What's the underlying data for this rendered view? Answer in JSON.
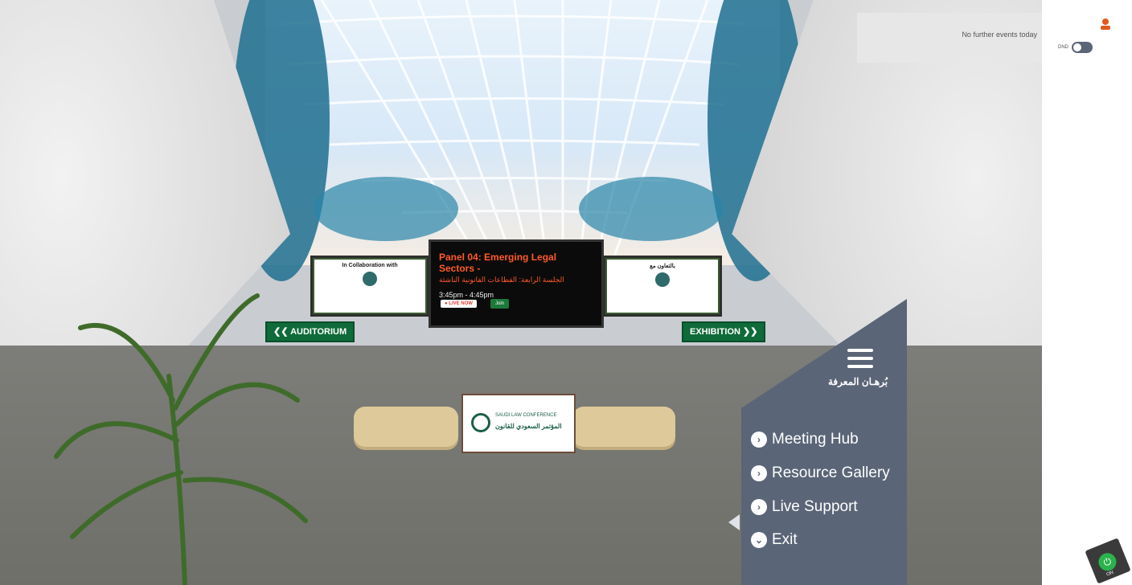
{
  "scene": {
    "screen_left_caption": "In Collaboration with",
    "screen_right_caption": "بالتعاون مع",
    "panel": {
      "title": "Panel 04: Emerging Legal Sectors -",
      "title_arabic": "الجلسة الرابعة: القطاعات القانونية الناشئة",
      "time": "3:45pm - 4:45pm",
      "live_label": "● LIVE NOW",
      "join_label": "Join"
    },
    "sign_auditorium": "❮❮ AUDITORIUM",
    "sign_exhibition": "EXHIBITION ❯❯",
    "centerpiece_en": "SAUDI LAW CONFERENCE",
    "centerpiece_ar": "المؤتمر السعودي للقانون"
  },
  "nav": {
    "brand": "بُرهـان المعرفة",
    "items": [
      {
        "label": "Meeting Hub",
        "icon": "›"
      },
      {
        "label": "Resource Gallery",
        "icon": "›"
      },
      {
        "label": "Live Support",
        "icon": "›"
      },
      {
        "label": "Exit",
        "icon": "⌄"
      }
    ]
  },
  "notifications": {
    "message": "No further events today"
  },
  "dnd": {
    "label": "DND"
  },
  "power": {
    "label": "ON"
  },
  "colors": {
    "nav_bg": "#5a6577",
    "sign_green": "#0f6b3a",
    "panel_accent": "#ff5a28"
  }
}
